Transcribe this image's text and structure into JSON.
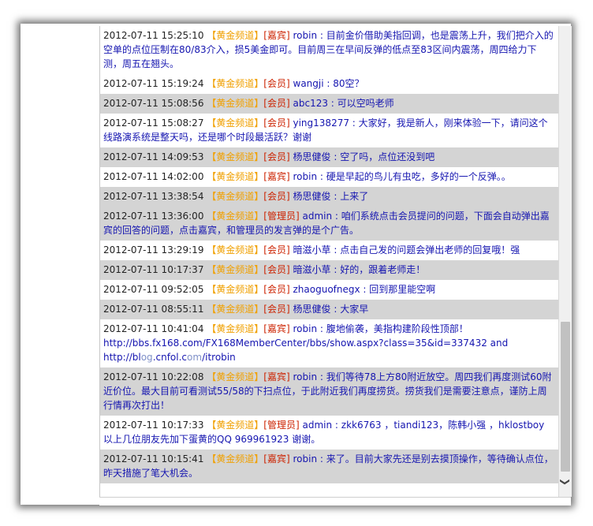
{
  "messages": [
    {
      "ts": "2012-07-11 15:25:10",
      "channel": "【黄金频道】",
      "role": "[嘉宾]",
      "user": "robin",
      "text": "目前金价借助美指回调，也是震荡上升，我们把介入的空单的点位压制在80/83介入，损5美金即可。目前周三在早间反弹的低点至83区间内震荡，周四给力下测，周五在翘头。",
      "shaded": false
    },
    {
      "ts": "2012-07-11 15:19:24",
      "channel": "【黄金频道】",
      "role": "[会员]",
      "user": "wangji",
      "text": "80空？",
      "shaded": false
    },
    {
      "ts": "2012-07-11 15:08:56",
      "channel": "【黄金频道】",
      "role": "[会员]",
      "user": "abc123",
      "text": "可以空吗老师",
      "shaded": true
    },
    {
      "ts": "2012-07-11 15:08:27",
      "channel": "【黄金频道】",
      "role": "[会员]",
      "user": "ying138277",
      "text": "大家好，我是新人，刚来体验一下，请问这个线路演系统是整天吗，还是哪个时段最活跃？谢谢",
      "shaded": false
    },
    {
      "ts": "2012-07-11 14:09:53",
      "channel": "【黄金频道】",
      "role": "[会员]",
      "user": "杨思健俊",
      "text": "空了吗，点位还没到吧",
      "shaded": true
    },
    {
      "ts": "2012-07-11 14:02:00",
      "channel": "【黄金频道】",
      "role": "[嘉宾]",
      "user": "robin",
      "text": "硬是早起的鸟儿有虫吃，多好的一个反弹。。",
      "shaded": false
    },
    {
      "ts": "2012-07-11 13:38:54",
      "channel": "【黄金频道】",
      "role": "[会员]",
      "user": "杨思健俊",
      "text": "上来了",
      "shaded": true
    },
    {
      "ts": "2012-07-11 13:36:00",
      "channel": "【黄金频道】",
      "role": "[管理员]",
      "user": "admin",
      "text": "咱们系统点击会员提问的问题，下面会自动弹出嘉宾的回答的问题，点击嘉宾，和管理员的发言弹的是个广告。",
      "shaded": true
    },
    {
      "ts": "2012-07-11 13:29:19",
      "channel": "【黄金频道】",
      "role": "[会员]",
      "user": "暗滋小草",
      "text": "点击自己发的问题会弹出老师的回复哦！强",
      "shaded": false
    },
    {
      "ts": "2012-07-11 10:17:37",
      "channel": "【黄金频道】",
      "role": "[会员]",
      "user": "暗滋小草",
      "text": "好的，跟着老师走！",
      "shaded": true
    },
    {
      "ts": "2012-07-11 09:52:05",
      "channel": "【黄金频道】",
      "role": "[会员]",
      "user": "zhaoguofnegx",
      "text": "回到那里能空啊",
      "shaded": false
    },
    {
      "ts": "2012-07-11 08:55:11",
      "channel": "【黄金频道】",
      "role": "[会员]",
      "user": "杨思健俊",
      "text": "大家早",
      "shaded": true
    },
    {
      "ts": "2012-07-11 10:41:04",
      "channel": "【黄金频道】",
      "role": "[嘉宾]",
      "user": "robin",
      "text": "腹地偷袭，美指构建阶段性顶部！",
      "link1": "http://bbs.fx168.com/FX168MemberCenter/bbs/show.aspx?class=35&id=337432 and",
      "link2a": "http://bl",
      "link2blur": "og",
      "link2b": ".cnfol.c",
      "link2blur2": "om",
      "link2c": "/itrobin",
      "shaded": false
    },
    {
      "ts": "2012-07-11 10:22:08",
      "channel": "【黄金频道】",
      "role": "[嘉宾]",
      "user": "robin",
      "text": "我们等待78上方80附近放空。周四我们再度测试60附近价位。最大目前可看测试55/58的下扫点位，于此附近我们再度捞货。捞货我们是需要注意点，谨防上周行情再次打出！",
      "shaded": true
    },
    {
      "ts": "2012-07-11 10:17:33",
      "channel": "【黄金频道】",
      "role": "[管理员]",
      "user": "admin",
      "text": "zkk6763 ，tiandi123，陈韩小强 ，hklostboy 以上几位朋友先加下蛋黄的QQ 969961923 谢谢。",
      "shaded": false
    },
    {
      "ts": "2012-07-11 10:15:41",
      "channel": "【黄金频道】",
      "role": "[嘉宾]",
      "user": "robin",
      "text": "来了。目前大家先还是别去摸顶操作，等待确认点位，昨天措施了笔大机会。",
      "shaded": true
    }
  ],
  "scrollbar": {
    "down_arrow": "❯"
  }
}
